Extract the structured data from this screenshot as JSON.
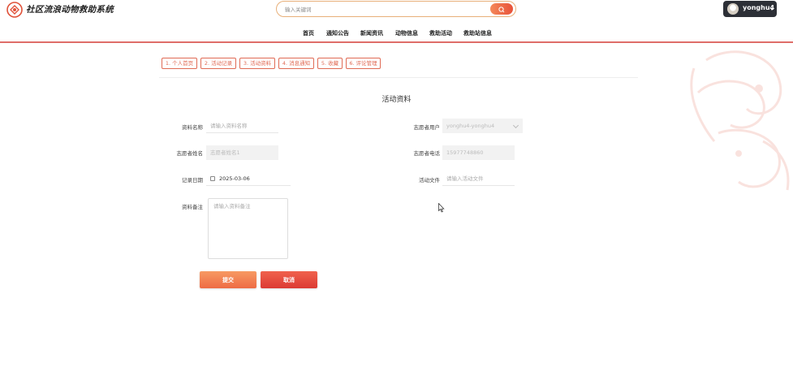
{
  "header": {
    "site_title": "社区流浪动物救助系统",
    "search_placeholder": "输入关键词",
    "user_name": "yonghu4",
    "nav": [
      "首页",
      "通知公告",
      "新闻资讯",
      "动物信息",
      "救助活动",
      "救助站信息"
    ]
  },
  "tabs": [
    "1. 个人首页",
    "2. 活动记录",
    "3. 活动资料",
    "4. 消息通知",
    "5. 收藏",
    "6. 评论管理"
  ],
  "page_title": "活动资料",
  "form": {
    "name_label": "资料名称",
    "name_placeholder": "请输入资料名称",
    "user_label": "志愿者用户",
    "user_value": "yonghu4-yonghu4",
    "volunteer_name_label": "志愿者姓名",
    "volunteer_name_value": "志愿者姓名1",
    "phone_label": "志愿者电话",
    "phone_value": "15977748860",
    "date_label": "记录日期",
    "date_value": "2025-03-06",
    "file_label": "活动文件",
    "file_placeholder": "请输入活动文件",
    "note_label": "资料备注",
    "note_placeholder": "请输入资料备注",
    "submit_label": "提交",
    "cancel_label": "取消"
  },
  "colors": {
    "accent": "#e06b55",
    "submit": "#ee6b44",
    "cancel": "#dc3a33",
    "header_line": "#d9534f"
  }
}
